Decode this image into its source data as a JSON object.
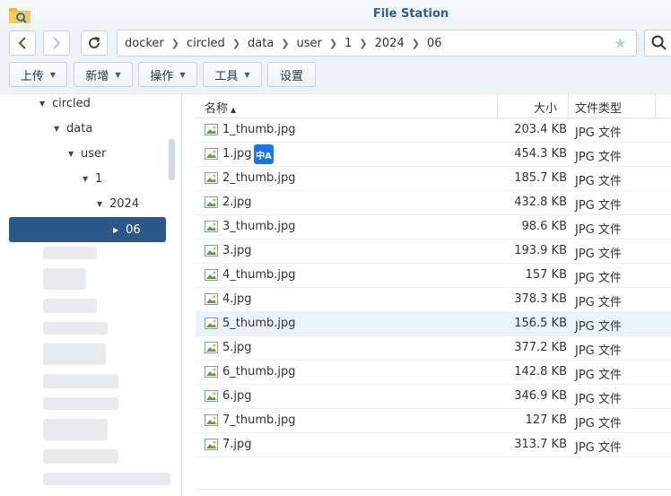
{
  "app": {
    "title": "File Station"
  },
  "nav": {
    "back_icon": "chevron-left-icon",
    "forward_icon": "chevron-right-icon",
    "refresh_icon": "refresh-icon",
    "breadcrumb": [
      "docker",
      "circled",
      "data",
      "user",
      "1",
      "2024",
      "06"
    ],
    "star_icon": "star-icon",
    "search_icon": "search-icon"
  },
  "toolbar": {
    "upload": "上传",
    "create": "新增",
    "action": "操作",
    "tools": "工具",
    "settings": "设置"
  },
  "sidebar": {
    "tree": [
      {
        "label": "circled"
      },
      {
        "label": "data"
      },
      {
        "label": "user"
      },
      {
        "label": "1"
      },
      {
        "label": "2024"
      }
    ],
    "selected": "06"
  },
  "columns": {
    "name": "名称",
    "size": "大小",
    "type": "文件类型"
  },
  "files": [
    {
      "name": "1_thumb.jpg",
      "size": "203.4 KB",
      "type": "JPG 文件"
    },
    {
      "name": "1.jpg",
      "size": "454.3 KB",
      "type": "JPG 文件",
      "badge": "中A"
    },
    {
      "name": "2_thumb.jpg",
      "size": "185.7 KB",
      "type": "JPG 文件"
    },
    {
      "name": "2.jpg",
      "size": "432.8 KB",
      "type": "JPG 文件"
    },
    {
      "name": "3_thumb.jpg",
      "size": "98.6 KB",
      "type": "JPG 文件"
    },
    {
      "name": "3.jpg",
      "size": "193.9 KB",
      "type": "JPG 文件"
    },
    {
      "name": "4_thumb.jpg",
      "size": "157 KB",
      "type": "JPG 文件"
    },
    {
      "name": "4.jpg",
      "size": "378.3 KB",
      "type": "JPG 文件"
    },
    {
      "name": "5_thumb.jpg",
      "size": "156.5 KB",
      "type": "JPG 文件"
    },
    {
      "name": "5.jpg",
      "size": "377.2 KB",
      "type": "JPG 文件"
    },
    {
      "name": "6_thumb.jpg",
      "size": "142.8 KB",
      "type": "JPG 文件"
    },
    {
      "name": "6.jpg",
      "size": "346.9 KB",
      "type": "JPG 文件"
    },
    {
      "name": "7_thumb.jpg",
      "size": "127 KB",
      "type": "JPG 文件"
    },
    {
      "name": "7.jpg",
      "size": "313.7 KB",
      "type": "JPG 文件"
    }
  ],
  "selected_file": "5_thumb.jpg",
  "colors": {
    "accent": "#2b5887",
    "title": "#2c5f8d",
    "selected_row": "#eaf2fb",
    "icon_green": "#6a9b3a"
  }
}
